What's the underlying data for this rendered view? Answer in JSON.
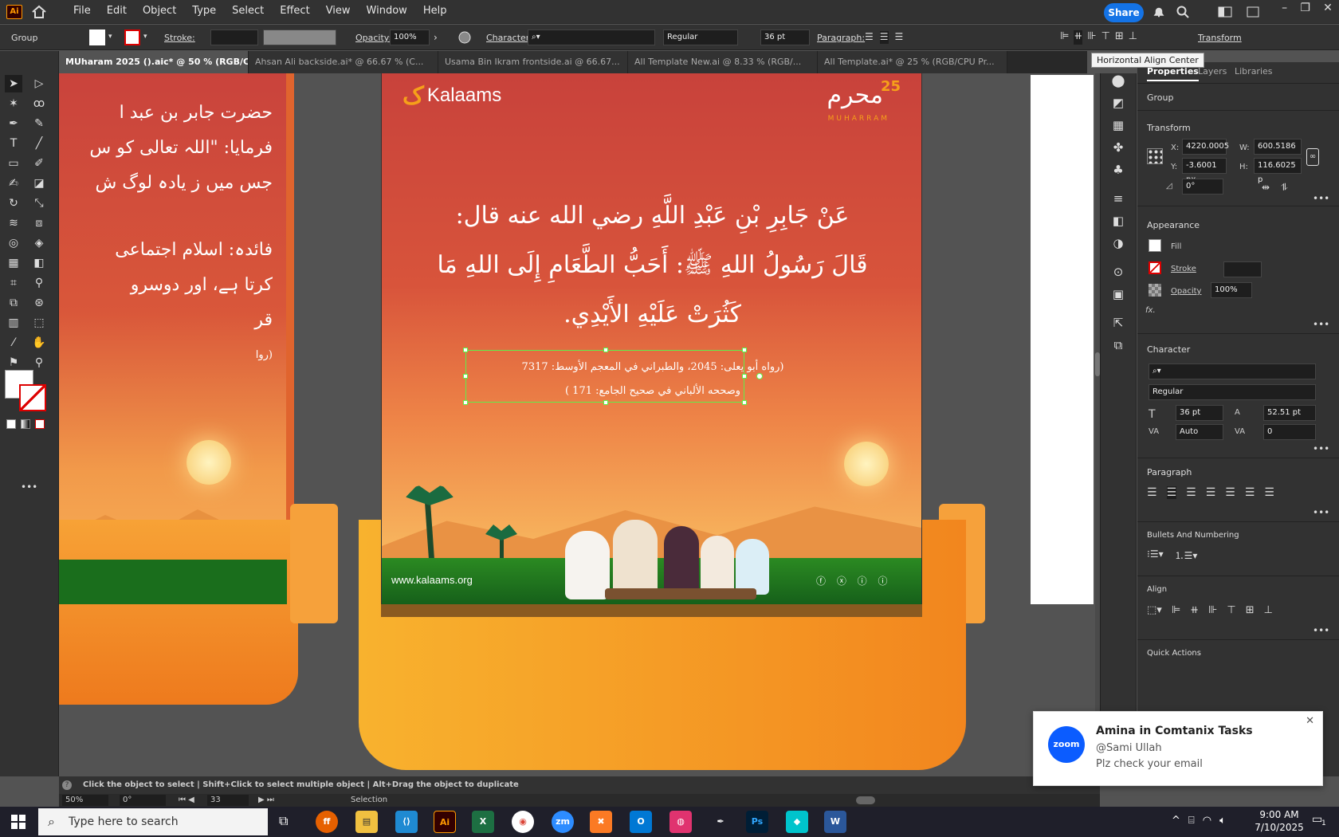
{
  "app": {
    "logo": "Ai",
    "menu": [
      "File",
      "Edit",
      "Object",
      "Type",
      "Select",
      "Effect",
      "View",
      "Window",
      "Help"
    ],
    "share": "Share"
  },
  "control": {
    "selection_type": "Group",
    "stroke_label": "Stroke:",
    "opacity_label": "Opacity:",
    "opacity_value": "100%",
    "character_label": "Character:",
    "font_style": "Regular",
    "font_size": "36 pt",
    "paragraph_label": "Paragraph:",
    "transform_label": "Transform",
    "tooltip": "Horizontal Align Center"
  },
  "tabs": [
    {
      "label": "MUharam 2025 ().aic* @ 50 % (RGB/CPU Preview)",
      "active": true
    },
    {
      "label": "Ahsan Ali backside.ai* @ 66.67 % (C...",
      "active": false
    },
    {
      "label": "Usama Bin Ikram frontside.ai @ 66.67...",
      "active": false
    },
    {
      "label": "All Template New.ai @ 8.33 % (RGB/...",
      "active": false
    },
    {
      "label": "All Template.ai* @ 25 % (RGB/CPU Pr...",
      "active": false
    }
  ],
  "artwork": {
    "brand": "Kalaams",
    "badge_number": "25",
    "badge_word": "محرم",
    "badge_sub": "MUHARRAM",
    "hadith_line1": "عَنْ جَابِرِ بْنِ عَبْدِ اللَّهِ رضي الله عنه قال:",
    "hadith_line2": "قَالَ رَسُولُ اللهِ ﷺ: أَحَبُّ الطَّعَامِ إِلَى اللهِ مَا",
    "hadith_line3": "كَثُرَتْ عَلَيْهِ الأَيْدِي.",
    "ref_line1": "(رواه أبو يعلى: 2045، والطبراني في المعجم الأوسط: 7317",
    "ref_line2": "وصححه الألباني في صحيح الجامع: 171 )",
    "website": "www.kalaams.org",
    "left_line1": "حضرت جابر بن عبد ا",
    "left_line2": "فرمایا: \"اللہ تعالی کو س",
    "left_line3": "جس میں ز یادہ لوگ ش",
    "left_line4": "فائدہ: اسلام اجتماعی",
    "left_line5": "کرتا ہے، اور دوسرو",
    "left_line6": "قر",
    "left_line7": "(روا"
  },
  "panel": {
    "tabs": [
      "Properties",
      "Layers",
      "Libraries"
    ],
    "group": "Group",
    "transform": "Transform",
    "x_label": "X:",
    "x": "4220.0005",
    "y_label": "Y:",
    "y": "-3.6001 px",
    "w_label": "W:",
    "w": "600.5186 p",
    "h_label": "H:",
    "h": "116.6025 p",
    "angle": "0°",
    "appearance": "Appearance",
    "fill": "Fill",
    "stroke": "Stroke",
    "opacity": "Opacity",
    "opacity_value": "100%",
    "fx": "fx.",
    "character": "Character",
    "font_style": "Regular",
    "font_size": "36 pt",
    "leading": "52.51 pt",
    "kerning": "Auto",
    "tracking": "0",
    "paragraph": "Paragraph",
    "bullets": "Bullets And Numbering",
    "align": "Align",
    "quick_actions": "Quick Actions"
  },
  "status": {
    "hint": "Click the object to select  |  Shift+Click to select multiple object  |  Alt+Drag the object to duplicate",
    "zoom": "50%",
    "rotation": "0°",
    "artboard": "33",
    "tool": "Selection"
  },
  "toast": {
    "title": "Amina in Comtanix Tasks",
    "user": "@Sami Ullah",
    "message": "Plz check your email",
    "app": "zoom"
  },
  "taskbar": {
    "search_placeholder": "Type here to search",
    "time": "9:00 AM",
    "date": "7/10/2025",
    "notif_count": "1"
  },
  "colors": {
    "accent": "#1473e6",
    "poster_top": "#c9433c",
    "poster_mid": "#e46a3a",
    "poster_bottom": "#f7a64a",
    "grass": "#1e7a1f",
    "orange": "#f08a22"
  }
}
